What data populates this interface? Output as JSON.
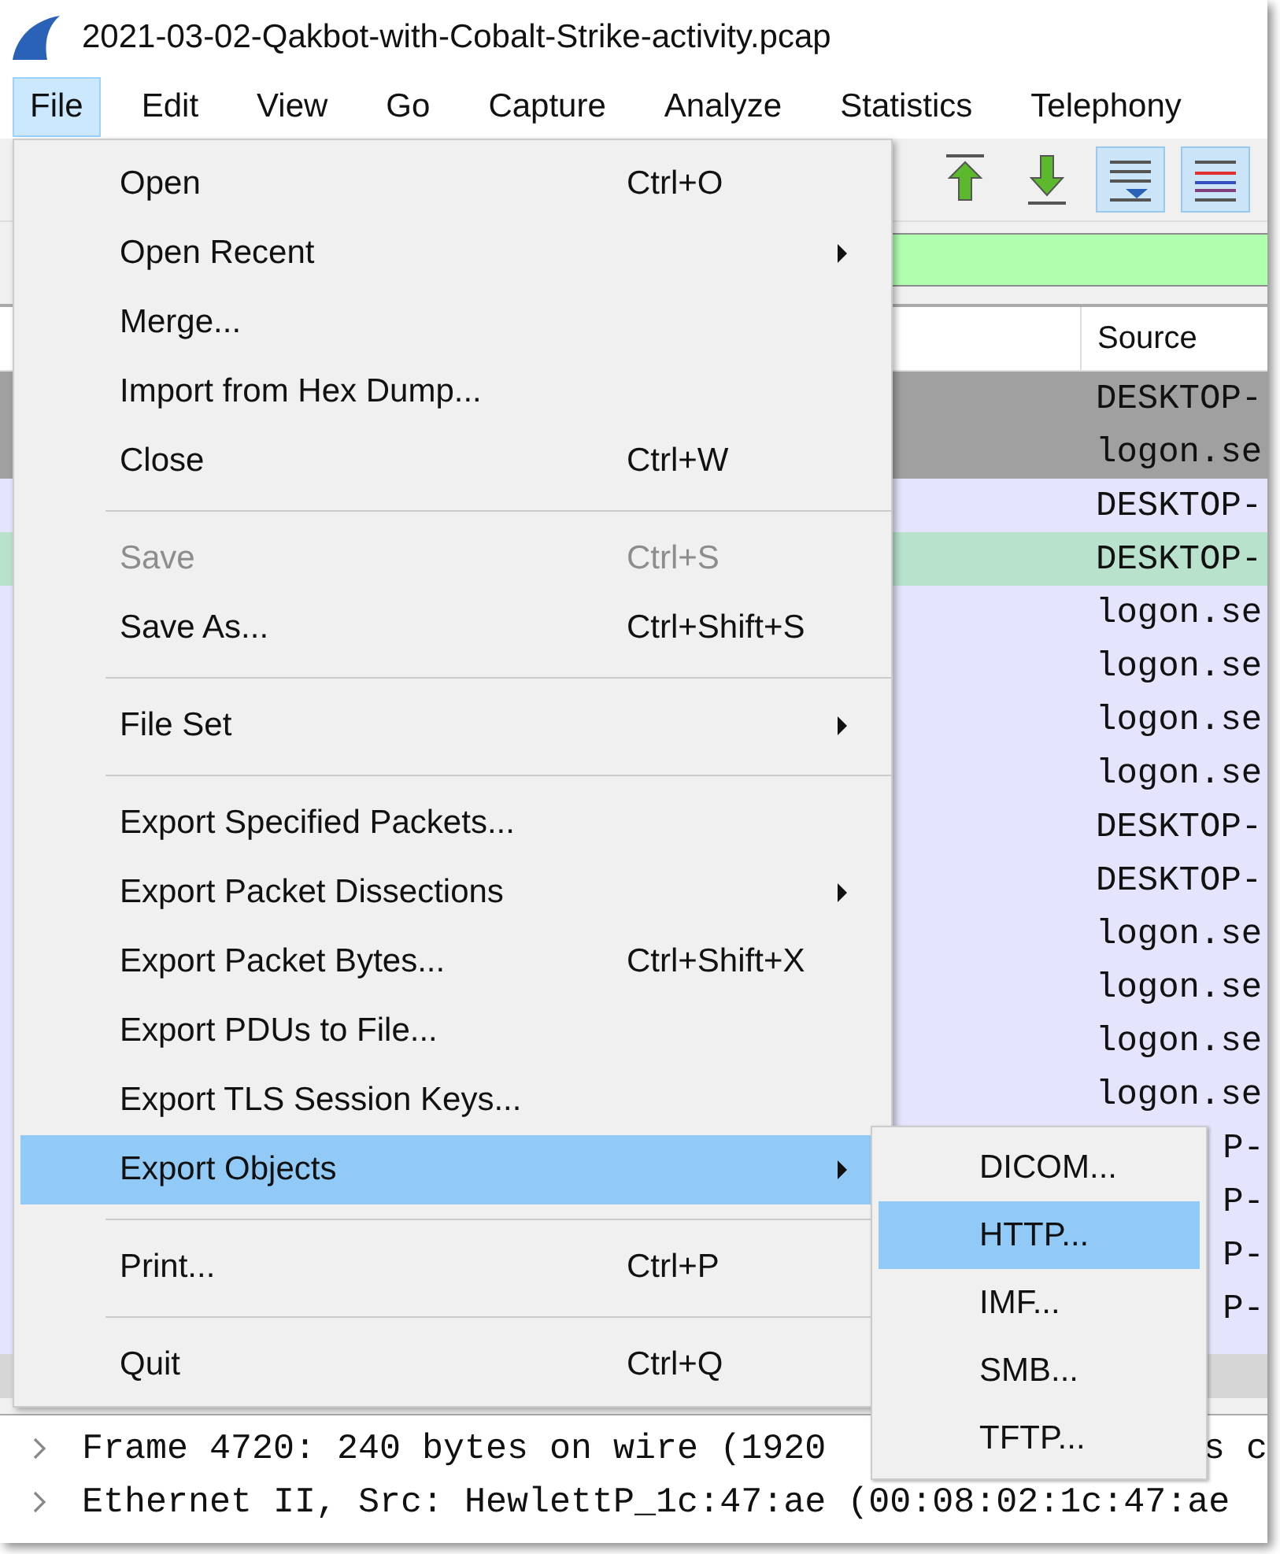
{
  "window": {
    "title": "2021-03-02-Qakbot-with-Cobalt-Strike-activity.pcap"
  },
  "menubar": [
    {
      "label": "File",
      "selected": true
    },
    {
      "label": "Edit",
      "selected": false
    },
    {
      "label": "View",
      "selected": false
    },
    {
      "label": "Go",
      "selected": false
    },
    {
      "label": "Capture",
      "selected": false
    },
    {
      "label": "Analyze",
      "selected": false
    },
    {
      "label": "Statistics",
      "selected": false
    },
    {
      "label": "Telephony",
      "selected": false
    }
  ],
  "toolbar": [
    {
      "kind": "up",
      "pressed": false
    },
    {
      "kind": "down",
      "pressed": false
    },
    {
      "kind": "autoscroll",
      "pressed": true
    },
    {
      "kind": "colorize",
      "pressed": true
    }
  ],
  "packet_list": {
    "columns": [
      "Source"
    ],
    "rows": [
      {
        "source": "DESKTOP-",
        "color": "#a0a0a0",
        "kind": "full"
      },
      {
        "source": "logon.se",
        "color": "#a0a0a0",
        "kind": "full"
      },
      {
        "source": "DESKTOP-",
        "color": "#e4e4fc",
        "kind": "full"
      },
      {
        "source": "DESKTOP-",
        "color": "#b8e2cc",
        "kind": "full"
      },
      {
        "source": "logon.se",
        "color": "#e4e4fc",
        "kind": "full"
      },
      {
        "source": "logon.se",
        "color": "#e4e4fc",
        "kind": "full"
      },
      {
        "source": "logon.se",
        "color": "#e4e4fc",
        "kind": "full"
      },
      {
        "source": "logon.se",
        "color": "#e4e4fc",
        "kind": "full"
      },
      {
        "source": "DESKTOP-",
        "color": "#e4e4fc",
        "kind": "full"
      },
      {
        "source": "DESKTOP-",
        "color": "#e4e4fc",
        "kind": "full"
      },
      {
        "source": "logon.se",
        "color": "#e4e4fc",
        "kind": "full"
      },
      {
        "source": "logon.se",
        "color": "#e4e4fc",
        "kind": "full"
      },
      {
        "source": "logon.se",
        "color": "#e4e4fc",
        "kind": "full"
      },
      {
        "source": "logon.se",
        "color": "#e4e4fc",
        "kind": "full"
      },
      {
        "source": "P-",
        "color": "#e4e4fc",
        "kind": "partial"
      },
      {
        "source": "P-",
        "color": "#e4e4fc",
        "kind": "partial"
      },
      {
        "source": "P-",
        "color": "#e4e4fc",
        "kind": "partial"
      },
      {
        "source": "P-",
        "color": "#e4e4fc",
        "kind": "partial"
      }
    ]
  },
  "details": [
    {
      "text": "Frame 4720: 240 bytes on wire (1920",
      "text_after": "s c"
    },
    {
      "text": "Ethernet II, Src: HewlettP_1c:47:ae (00:08:02:1c:47:ae"
    }
  ],
  "file_menu": [
    {
      "kind": "item",
      "label": "Open",
      "shortcut": "Ctrl+O",
      "disabled": false,
      "selected": false,
      "submenu": false
    },
    {
      "kind": "item",
      "label": "Open Recent",
      "disabled": false,
      "selected": false,
      "submenu": true
    },
    {
      "kind": "item",
      "label": "Merge...",
      "disabled": false,
      "selected": false,
      "submenu": false
    },
    {
      "kind": "item",
      "label": "Import from Hex Dump...",
      "disabled": false,
      "selected": false,
      "submenu": false
    },
    {
      "kind": "item",
      "label": "Close",
      "shortcut": "Ctrl+W",
      "disabled": false,
      "selected": false,
      "submenu": false
    },
    {
      "kind": "separator"
    },
    {
      "kind": "item",
      "label": "Save",
      "shortcut": "Ctrl+S",
      "disabled": true,
      "selected": false,
      "submenu": false
    },
    {
      "kind": "item",
      "label": "Save As...",
      "shortcut": "Ctrl+Shift+S",
      "disabled": false,
      "selected": false,
      "submenu": false
    },
    {
      "kind": "separator"
    },
    {
      "kind": "item",
      "label": "File Set",
      "disabled": false,
      "selected": false,
      "submenu": true
    },
    {
      "kind": "separator"
    },
    {
      "kind": "item",
      "label": "Export Specified Packets...",
      "disabled": false,
      "selected": false,
      "submenu": false
    },
    {
      "kind": "item",
      "label": "Export Packet Dissections",
      "disabled": false,
      "selected": false,
      "submenu": true
    },
    {
      "kind": "item",
      "label": "Export Packet Bytes...",
      "shortcut": "Ctrl+Shift+X",
      "disabled": false,
      "selected": false,
      "submenu": false
    },
    {
      "kind": "item",
      "label": "Export PDUs to File...",
      "disabled": false,
      "selected": false,
      "submenu": false
    },
    {
      "kind": "item",
      "label": "Export TLS Session Keys...",
      "disabled": false,
      "selected": false,
      "submenu": false
    },
    {
      "kind": "item",
      "label": "Export Objects",
      "disabled": false,
      "selected": true,
      "submenu": true
    },
    {
      "kind": "separator"
    },
    {
      "kind": "item",
      "label": "Print...",
      "shortcut": "Ctrl+P",
      "disabled": false,
      "selected": false,
      "submenu": false
    },
    {
      "kind": "separator"
    },
    {
      "kind": "item",
      "label": "Quit",
      "shortcut": "Ctrl+Q",
      "disabled": false,
      "selected": false,
      "submenu": false
    }
  ],
  "export_objects_menu": [
    {
      "label": "DICOM...",
      "selected": false
    },
    {
      "label": "HTTP...",
      "selected": true
    },
    {
      "label": "IMF...",
      "selected": false
    },
    {
      "label": "SMB...",
      "selected": false
    },
    {
      "label": "TFTP...",
      "selected": false
    }
  ]
}
